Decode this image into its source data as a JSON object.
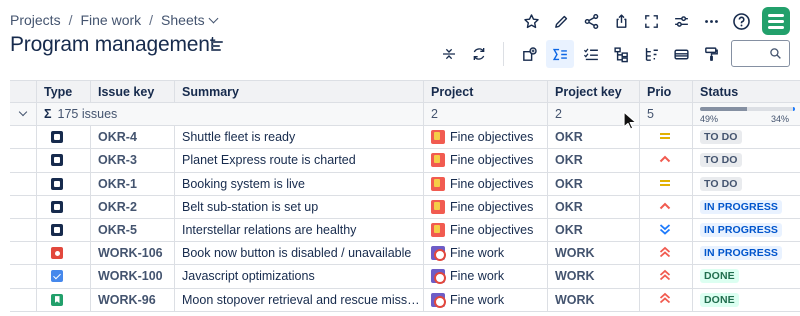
{
  "breadcrumb": {
    "items": [
      "Projects",
      "Fine work",
      "Sheets"
    ]
  },
  "page": {
    "title": "Program management"
  },
  "search": {
    "placeholder": "",
    "value": ""
  },
  "columns": {
    "type": "Type",
    "issue_key": "Issue key",
    "summary": "Summary",
    "project": "Project",
    "project_key": "Project key",
    "prio": "Prio",
    "status": "Status"
  },
  "group": {
    "sigma": "Σ",
    "issues_label": "175 issues",
    "project_count": "2",
    "project_key_count": "2",
    "prio_count": "5",
    "status_todo_pct_label": "49%",
    "status_prog_pct_label": "34%",
    "status_todo_fraction": 0.49,
    "status_prog_fraction": 0.34
  },
  "rows": [
    {
      "type": "task-dark",
      "key": "OKR-4",
      "summary": "Shuttle fleet is ready",
      "project": "Fine objectives",
      "project_icon": "okr",
      "project_key": "OKR",
      "prio": "medium",
      "status": "TO DO",
      "status_kind": "todo"
    },
    {
      "type": "task-dark",
      "key": "OKR-3",
      "summary": "Planet Express route is charted",
      "project": "Fine objectives",
      "project_icon": "okr",
      "project_key": "OKR",
      "prio": "high",
      "status": "TO DO",
      "status_kind": "todo"
    },
    {
      "type": "task-dark",
      "key": "OKR-1",
      "summary": "Booking system is live",
      "project": "Fine objectives",
      "project_icon": "okr",
      "project_key": "OKR",
      "prio": "medium",
      "status": "TO DO",
      "status_kind": "todo"
    },
    {
      "type": "task-dark",
      "key": "OKR-2",
      "summary": "Belt sub-station is set up",
      "project": "Fine objectives",
      "project_icon": "okr",
      "project_key": "OKR",
      "prio": "high",
      "status": "IN PROGRESS",
      "status_kind": "progress"
    },
    {
      "type": "task-dark",
      "key": "OKR-5",
      "summary": "Interstellar relations are healthy",
      "project": "Fine objectives",
      "project_icon": "okr",
      "project_key": "OKR",
      "prio": "lowest",
      "status": "IN PROGRESS",
      "status_kind": "progress"
    },
    {
      "type": "bug",
      "key": "WORK-106",
      "summary": "Book now button is disabled / unavailable",
      "project": "Fine work",
      "project_icon": "work",
      "project_key": "WORK",
      "prio": "highest",
      "status": "IN PROGRESS",
      "status_kind": "progress"
    },
    {
      "type": "task-blue",
      "key": "WORK-100",
      "summary": "Javascript optimizations",
      "project": "Fine work",
      "project_icon": "work",
      "project_key": "WORK",
      "prio": "highest",
      "status": "DONE",
      "status_kind": "done"
    },
    {
      "type": "story",
      "key": "WORK-96",
      "summary": "Moon stopover retrieval and rescue mission t...",
      "project": "Fine work",
      "project_icon": "work",
      "project_key": "WORK",
      "prio": "highest",
      "status": "DONE",
      "status_kind": "done"
    }
  ],
  "colors": {
    "accent": "#0c66e4",
    "logo": "#22a06b",
    "prio_medium": "#e2b203",
    "prio_high": "#f15b50",
    "prio_low": "#1d7afc"
  }
}
